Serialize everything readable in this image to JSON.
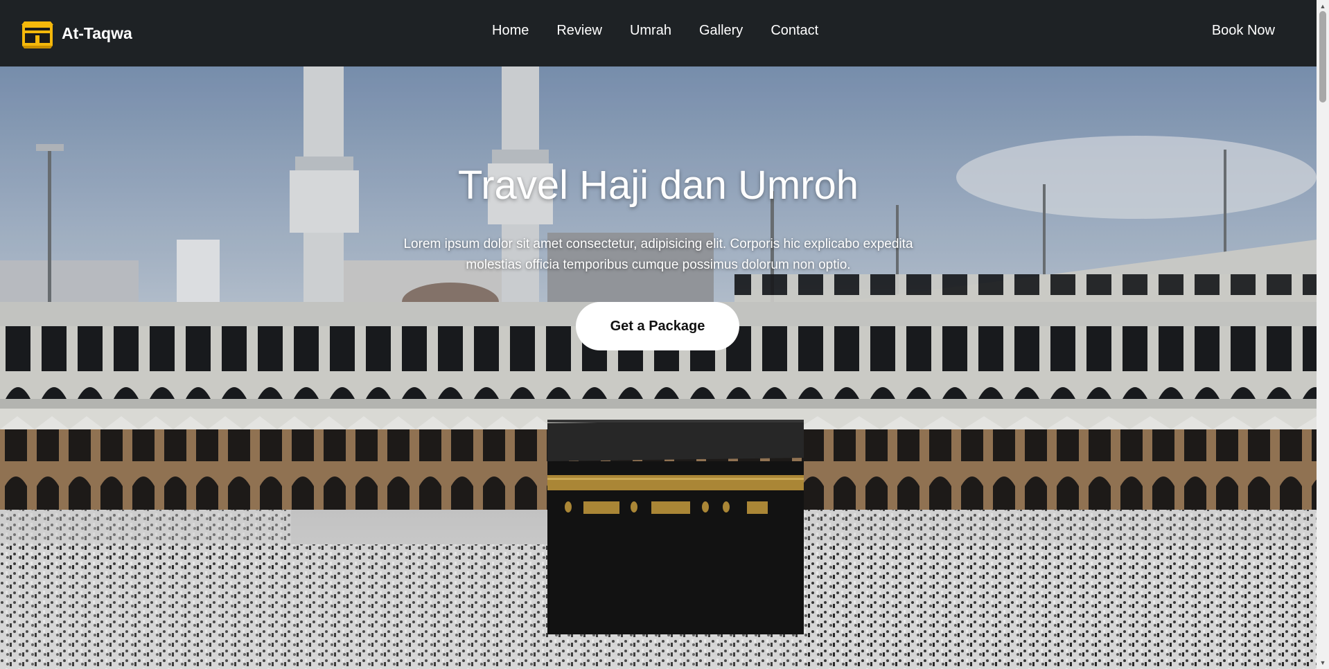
{
  "brand": {
    "name": "At-Taqwa",
    "logo_icon": "kaaba-logo-icon",
    "accent": "#f5b80b"
  },
  "nav": {
    "items": [
      {
        "label": "Home"
      },
      {
        "label": "Review"
      },
      {
        "label": "Umrah"
      },
      {
        "label": "Gallery"
      },
      {
        "label": "Contact"
      }
    ],
    "book_label": "Book Now"
  },
  "hero": {
    "title": "Travel Haji dan Umroh",
    "description": "Lorem ipsum dolor sit amet consectetur, adipisicing elit. Corporis hic explicabo expedita molestias officia temporibus cumque possimus dolorum non optio.",
    "cta_label": "Get a Package",
    "background": "masjid-al-haram-kaaba-photo"
  },
  "colors": {
    "navbar": "#1e2225",
    "cta_bg": "#ffffff",
    "text": "#ffffff"
  }
}
